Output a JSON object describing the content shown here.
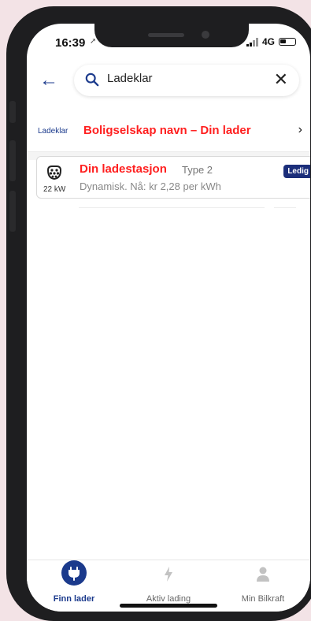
{
  "status_bar": {
    "time": "16:39",
    "location_arrow": "➚",
    "network": "4G"
  },
  "search": {
    "back_icon": "arrow-left-icon",
    "value": "Ladeklar",
    "clear_label": "✕"
  },
  "operator": {
    "logo_text": "Ladeklar",
    "name": "Boligselskap navn – Din lader",
    "chevron": "›"
  },
  "station": {
    "power": "22 kW",
    "name": "Din ladestasjon",
    "connector_type": "Type 2",
    "price_text": "Dynamisk. Nå: kr 2,28 per kWh",
    "status_badge": "Ledig"
  },
  "tabs": [
    {
      "label": "Finn lader",
      "icon": "plug-icon",
      "active": true
    },
    {
      "label": "Aktiv lading",
      "icon": "lightning-icon",
      "active": false
    },
    {
      "label": "Min Bilkraft",
      "icon": "person-icon",
      "active": false
    }
  ],
  "colors": {
    "accent": "#1b3a8c",
    "highlight_red": "#ff1f1f",
    "badge_bg": "#1b2e7a",
    "background": "#f3e3e6"
  }
}
